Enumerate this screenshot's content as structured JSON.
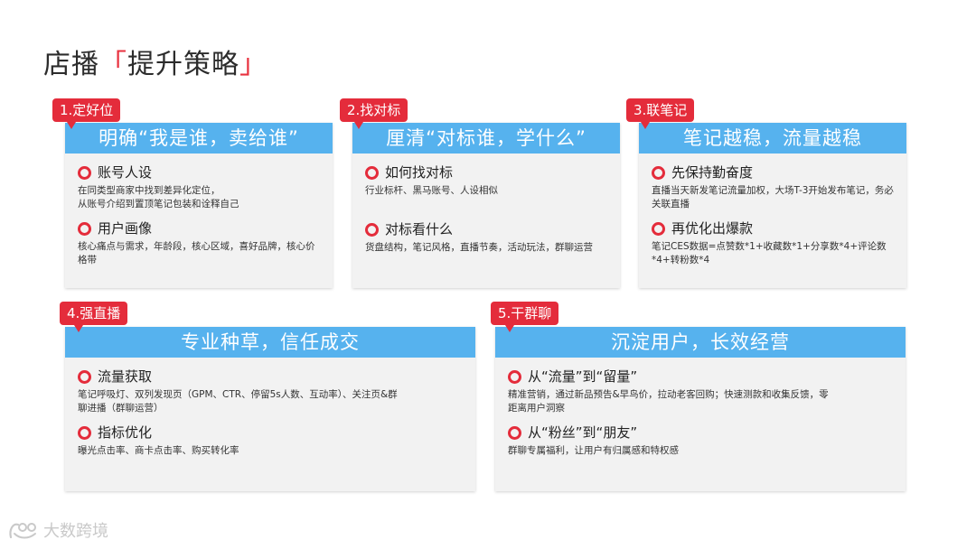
{
  "title": {
    "main": "店播",
    "open": "「",
    "accent": "提升策略",
    "close": "」"
  },
  "cards": [
    {
      "tag": "1.定好位",
      "header": "明确“我是谁，卖给谁”",
      "items": [
        {
          "head": "账号人设",
          "desc": "在同类型商家中找到差异化定位，\n从账号介绍到置顶笔记包装和诠释自己"
        },
        {
          "head": "用户画像",
          "desc": "核心痛点与需求，年龄段，核心区域，喜好品牌，核心价格带"
        }
      ]
    },
    {
      "tag": "2.找对标",
      "header": "厘清“对标谁，学什么”",
      "items": [
        {
          "head": "如何找对标",
          "desc": "行业标杆、黑马账号、人设相似"
        },
        {
          "head": "对标看什么",
          "desc": "货盘结构，笔记风格，直播节奏，活动玩法，群聊运营"
        }
      ]
    },
    {
      "tag": "3.联笔记",
      "header": "笔记越稳，流量越稳",
      "items": [
        {
          "head": "先保持勤奋度",
          "desc": "直播当天新发笔记流量加权，大场T-3开始发布笔记，务必关联直播"
        },
        {
          "head": "再优化出爆款",
          "desc": "笔记CES数据=点赞数*1+收藏数*1+分享数*4+评论数*4+转粉数*4"
        }
      ]
    },
    {
      "tag": "4.强直播",
      "header": "专业种草，信任成交",
      "items": [
        {
          "head": "流量获取",
          "desc": "笔记呼吸灯、双列发现页（GPM、CTR、停留5s人数、互动率）、关注页&群聊进播（群聊运营）"
        },
        {
          "head": "指标优化",
          "desc": "曝光点击率、商卡点击率、购买转化率"
        }
      ]
    },
    {
      "tag": "5.干群聊",
      "header": "沉淀用户，长效经营",
      "items": [
        {
          "head": "从“流量”到“留量”",
          "desc": "精准营销，通过新品预告&早鸟价，拉动老客回购；快速测款和收集反馈，零距离用户洞察"
        },
        {
          "head": "从“粉丝”到“朋友”",
          "desc": "群聊专属福利，让用户有归属感和特权感"
        }
      ]
    }
  ],
  "logo": {
    "text": "大数跨境",
    "icon": "brand-logo-icon"
  },
  "colors": {
    "accent_red": "#e42c3b",
    "header_blue": "#56b2ee",
    "card_bg": "#f2f2f2"
  }
}
